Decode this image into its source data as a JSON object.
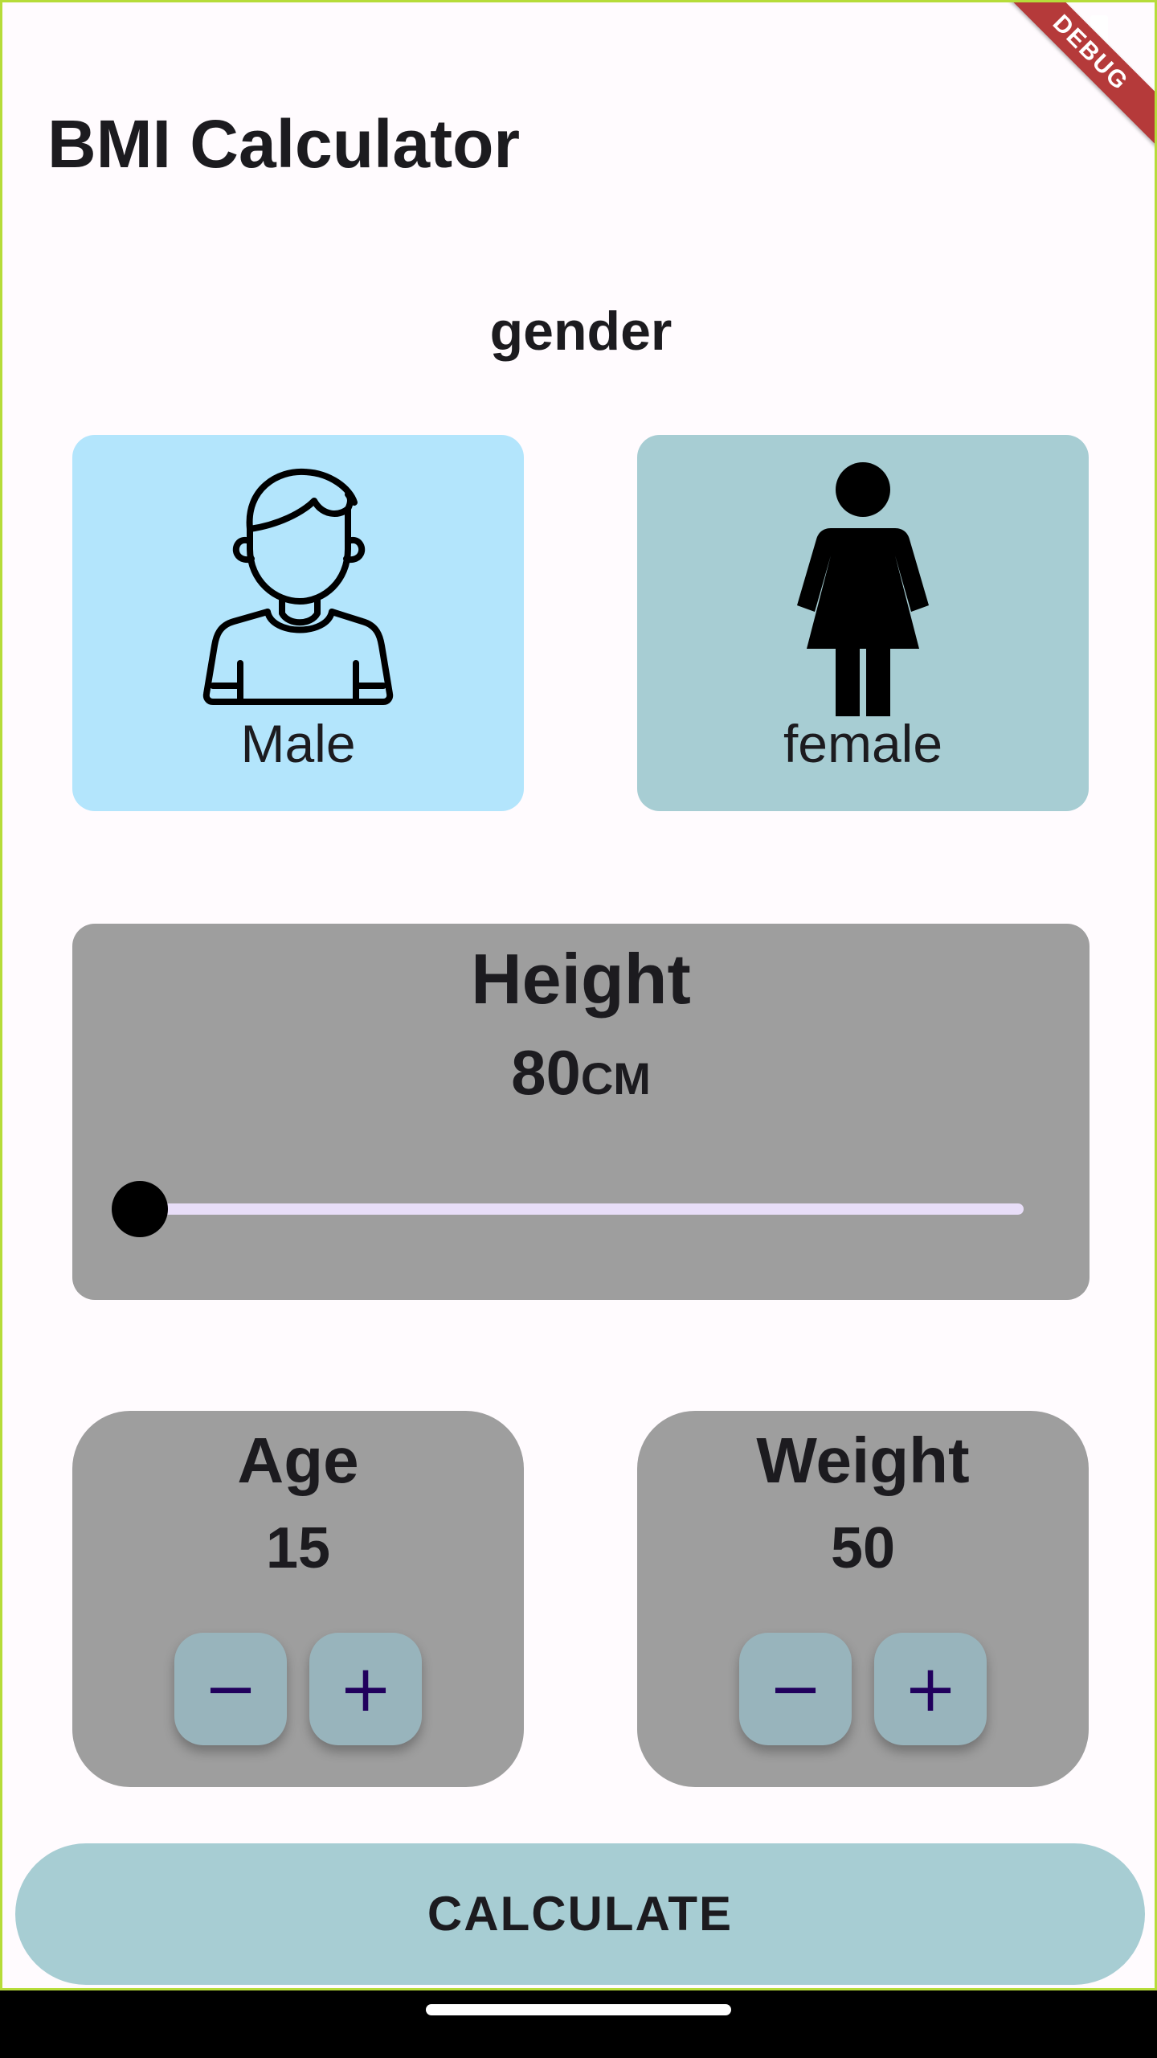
{
  "status_bar": {
    "debug_label": "DEBUG"
  },
  "app": {
    "title": "BMI Calculator"
  },
  "gender": {
    "title": "gender",
    "male_label": "Male",
    "female_label": "female",
    "selected": "male"
  },
  "height": {
    "title": "Height",
    "value": "80",
    "unit": "CM",
    "slider_fraction": 0.0
  },
  "age": {
    "title": "Age",
    "value": "15",
    "minus_label": "−",
    "plus_label": "+"
  },
  "weight": {
    "title": "Weight",
    "value": "50",
    "minus_label": "−",
    "plus_label": "+"
  },
  "calculate": {
    "label": "CALCULATE"
  },
  "colors": {
    "background": "#fffbfe",
    "male_card": "#b3e5fc",
    "female_card": "#a7cdd3",
    "panel": "#9e9e9e",
    "stepper": "#98b4bc",
    "stepper_text": "#21005d",
    "slider_track": "#e8def8",
    "calculate_button": "#a7cdd3",
    "debug_banner": "#b53a3a"
  }
}
